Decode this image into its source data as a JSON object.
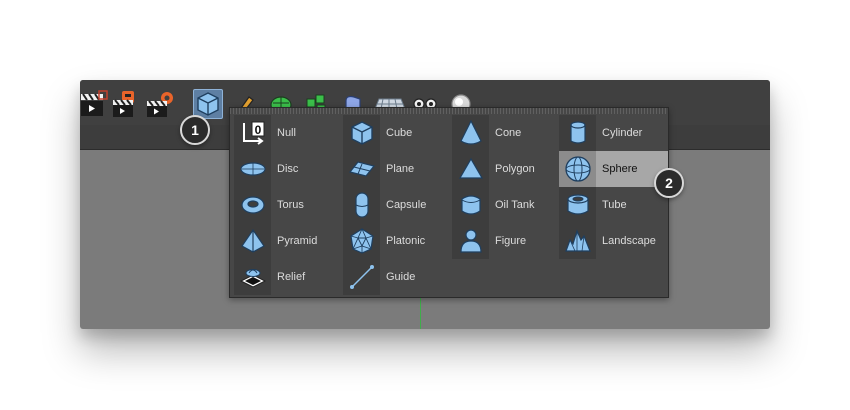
{
  "callouts": [
    {
      "number": "1"
    },
    {
      "number": "2"
    }
  ],
  "menu": {
    "columns": [
      [
        {
          "label": "Null",
          "icon": "null-icon"
        },
        {
          "label": "Disc",
          "icon": "disc-icon"
        },
        {
          "label": "Torus",
          "icon": "torus-icon"
        },
        {
          "label": "Pyramid",
          "icon": "pyramid-icon"
        },
        {
          "label": "Relief",
          "icon": "relief-icon"
        }
      ],
      [
        {
          "label": "Cube",
          "icon": "cube-icon"
        },
        {
          "label": "Plane",
          "icon": "plane-icon"
        },
        {
          "label": "Capsule",
          "icon": "capsule-icon"
        },
        {
          "label": "Platonic",
          "icon": "platonic-icon"
        },
        {
          "label": "Guide",
          "icon": "guide-icon"
        }
      ],
      [
        {
          "label": "Cone",
          "icon": "cone-icon"
        },
        {
          "label": "Polygon",
          "icon": "polygon-icon"
        },
        {
          "label": "Oil Tank",
          "icon": "oil-tank-icon"
        },
        {
          "label": "Figure",
          "icon": "figure-icon"
        }
      ],
      [
        {
          "label": "Cylinder",
          "icon": "cylinder-icon"
        },
        {
          "label": "Sphere",
          "icon": "sphere-icon",
          "highlighted": true
        },
        {
          "label": "Tube",
          "icon": "tube-icon"
        },
        {
          "label": "Landscape",
          "icon": "landscape-icon"
        }
      ]
    ]
  },
  "colors": {
    "icon_blue": "#8ec3ee",
    "icon_stroke": "#1f3f5f",
    "highlight": "#a7a7a7",
    "axis_green": "#3fae4a"
  }
}
